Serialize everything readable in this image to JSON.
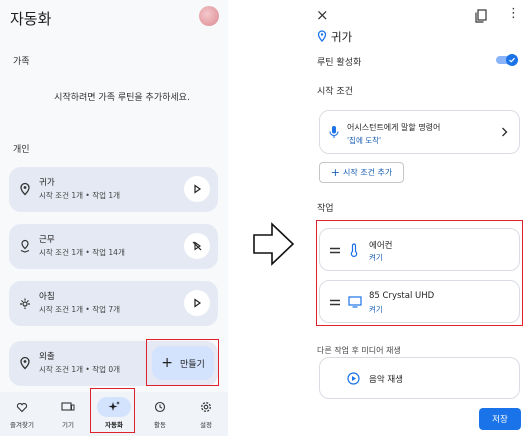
{
  "left": {
    "app_title": "자동화",
    "section_family": "가족",
    "family_empty": "시작하려면 가족 루틴을 추가하세요.",
    "section_personal": "개인",
    "routines": [
      {
        "name": "귀가",
        "detail": "시작 조건 1개 • 작업 1개",
        "icon": "location-pin-icon",
        "action_icon": "play-icon"
      },
      {
        "name": "근무",
        "detail": "시작 조건 1개 • 작업 14개",
        "icon": "work-location-icon",
        "action_icon": "play-disabled-icon"
      },
      {
        "name": "아침",
        "detail": "시작 조건 1개 • 작업 7개",
        "icon": "sunrise-icon",
        "action_icon": "play-icon"
      },
      {
        "name": "외출",
        "detail": "시작 조건 1개 • 작업 0개",
        "icon": "location-pin-icon",
        "action_icon": ""
      }
    ],
    "fab_label": "만들기",
    "nav": [
      {
        "label": "즐겨찾기",
        "icon": "heart-icon"
      },
      {
        "label": "기기",
        "icon": "devices-icon"
      },
      {
        "label": "자동화",
        "icon": "sparkle-icon",
        "active": true
      },
      {
        "label": "활동",
        "icon": "history-icon"
      },
      {
        "label": "설정",
        "icon": "gear-icon"
      }
    ]
  },
  "right": {
    "routine_name": "귀가",
    "enable_label": "루틴 활성화",
    "enabled": true,
    "start_conditions_label": "시작 조건",
    "starter_title": "어시스턴트에게 말할 명령어",
    "starter_value": "'집에 도착'",
    "add_starter_label": "시작 조건 추가",
    "actions_label": "작업",
    "actions": [
      {
        "name": "에어컨",
        "state": "켜기",
        "icon": "thermometer-icon"
      },
      {
        "name": "85 Crystal UHD",
        "state": "켜기",
        "icon": "tv-icon"
      }
    ],
    "media_label": "다른 작업 후 미디어 재생",
    "media_action": "음악 재생",
    "save_label": "저장"
  },
  "colors": {
    "accent": "#1a73e8",
    "highlight": "#e0202a",
    "card_bg": "#e4e9f3",
    "fab_bg": "#d3e3fd"
  }
}
